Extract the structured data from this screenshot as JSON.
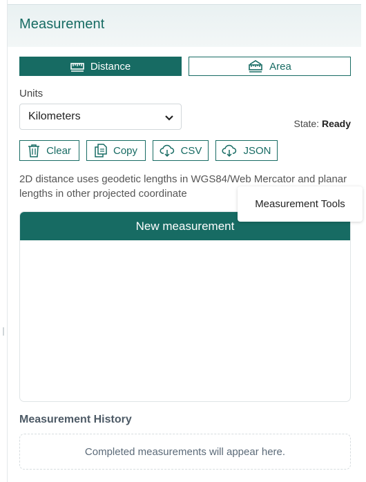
{
  "panel": {
    "title": "Measurement"
  },
  "modes": {
    "distance_label": "Distance",
    "area_label": "Area",
    "active": "Distance"
  },
  "units": {
    "label": "Units",
    "selected": "Kilometers"
  },
  "state": {
    "label": "State:",
    "value": "Ready"
  },
  "actions": {
    "clear": "Clear",
    "copy": "Copy",
    "csv": "CSV",
    "json": "JSON"
  },
  "description": "2D distance uses geodetic lengths in WGS84/Web Mercator and planar lengths in other projected coordinate",
  "tooltip": {
    "text": "Measurement Tools"
  },
  "new_measurement": {
    "header": "New measurement"
  },
  "history": {
    "title": "Measurement History",
    "empty_text": "Completed measurements will appear here."
  },
  "colors": {
    "accent": "#176b63",
    "header_bg": "#e9f1f2"
  },
  "icons": {
    "distance": "ruler-icon",
    "area": "area-ruler-icon",
    "clear": "trash-icon",
    "copy": "copy-document-icon",
    "csv": "cloud-download-icon",
    "json": "cloud-download-icon",
    "dropdown": "chevron-down-icon"
  }
}
